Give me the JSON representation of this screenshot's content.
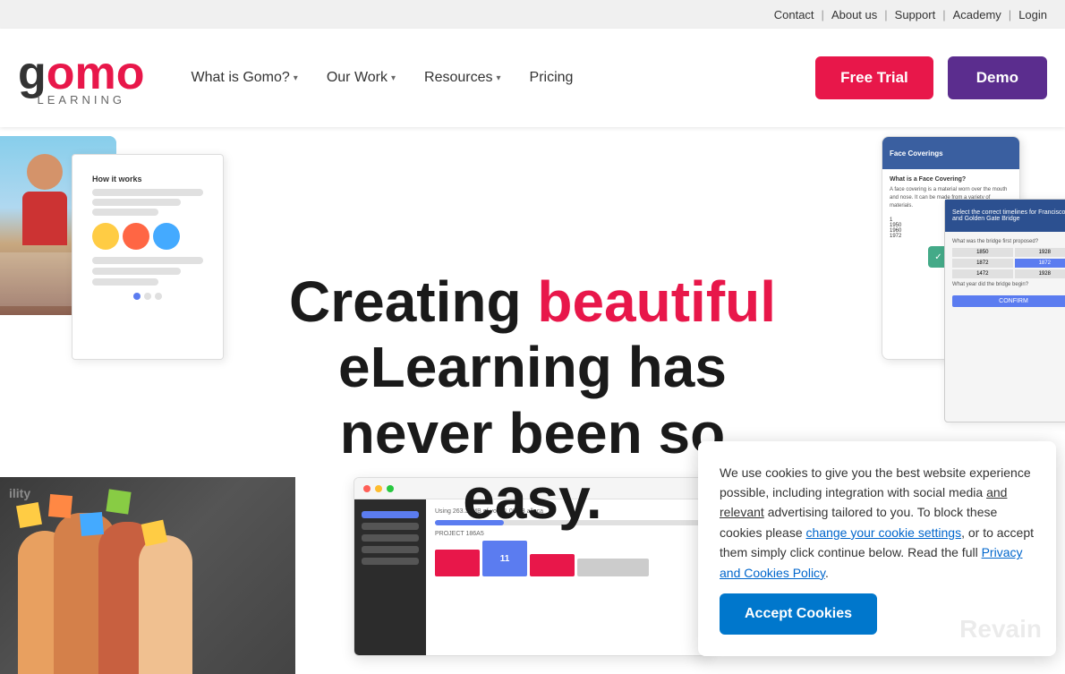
{
  "utility_bar": {
    "contact": "Contact",
    "about_us": "About us",
    "support": "Support",
    "academy": "Academy",
    "login": "Login",
    "sep": "|"
  },
  "logo": {
    "g": "g",
    "omo": "omo",
    "learning": "LEARNING"
  },
  "nav": {
    "what_is_gomo": "What is Gomo?",
    "our_work": "Our Work",
    "resources": "Resources",
    "pricing": "Pricing"
  },
  "cta": {
    "free_trial": "Free Trial",
    "demo": "Demo"
  },
  "hero": {
    "line1": "Creating ",
    "line1_accent": "beautiful",
    "line2": "eLearning has",
    "line3": "never been so easy."
  },
  "cookie": {
    "body1": "We use cookies to give you the best website experience possible, including integration with social media ",
    "body2": "and relevant",
    "body3": " advertising tailored to you. To block these cookies please ",
    "change_settings_link": "change your cookie settings",
    "body4": ", or to accept them simply click continue below. Read the full ",
    "privacy_link": "Privacy and Cookies Policy",
    "body5": ".",
    "accept_btn": "Accept Cookies"
  }
}
